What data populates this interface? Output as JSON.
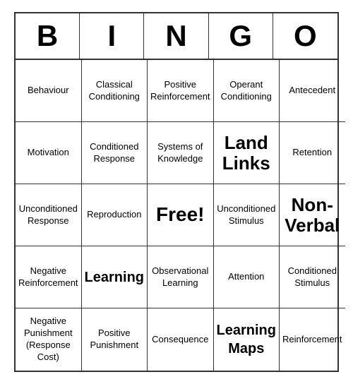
{
  "header": {
    "letters": [
      "B",
      "I",
      "N",
      "G",
      "O"
    ]
  },
  "cells": [
    {
      "text": "Behaviour",
      "size": "normal"
    },
    {
      "text": "Classical Conditioning",
      "size": "normal"
    },
    {
      "text": "Positive Reinforcement",
      "size": "small"
    },
    {
      "text": "Operant Conditioning",
      "size": "normal"
    },
    {
      "text": "Antecedent",
      "size": "normal"
    },
    {
      "text": "Motivation",
      "size": "normal"
    },
    {
      "text": "Conditioned Response",
      "size": "normal"
    },
    {
      "text": "Systems of Knowledge",
      "size": "normal"
    },
    {
      "text": "Land Links",
      "size": "large"
    },
    {
      "text": "Retention",
      "size": "normal"
    },
    {
      "text": "Unconditioned Response",
      "size": "small"
    },
    {
      "text": "Reproduction",
      "size": "normal"
    },
    {
      "text": "Free!",
      "size": "free"
    },
    {
      "text": "Unconditioned Stimulus",
      "size": "small"
    },
    {
      "text": "Non-Verbal",
      "size": "large"
    },
    {
      "text": "Negative Reinforcement",
      "size": "small"
    },
    {
      "text": "Learning",
      "size": "medium"
    },
    {
      "text": "Observational Learning",
      "size": "small"
    },
    {
      "text": "Attention",
      "size": "normal"
    },
    {
      "text": "Conditioned Stimulus",
      "size": "small"
    },
    {
      "text": "Negative Punishment (Response Cost)",
      "size": "small"
    },
    {
      "text": "Positive Punishment",
      "size": "normal"
    },
    {
      "text": "Consequence",
      "size": "normal"
    },
    {
      "text": "Learning Maps",
      "size": "medium"
    },
    {
      "text": "Reinforcement",
      "size": "normal"
    }
  ]
}
